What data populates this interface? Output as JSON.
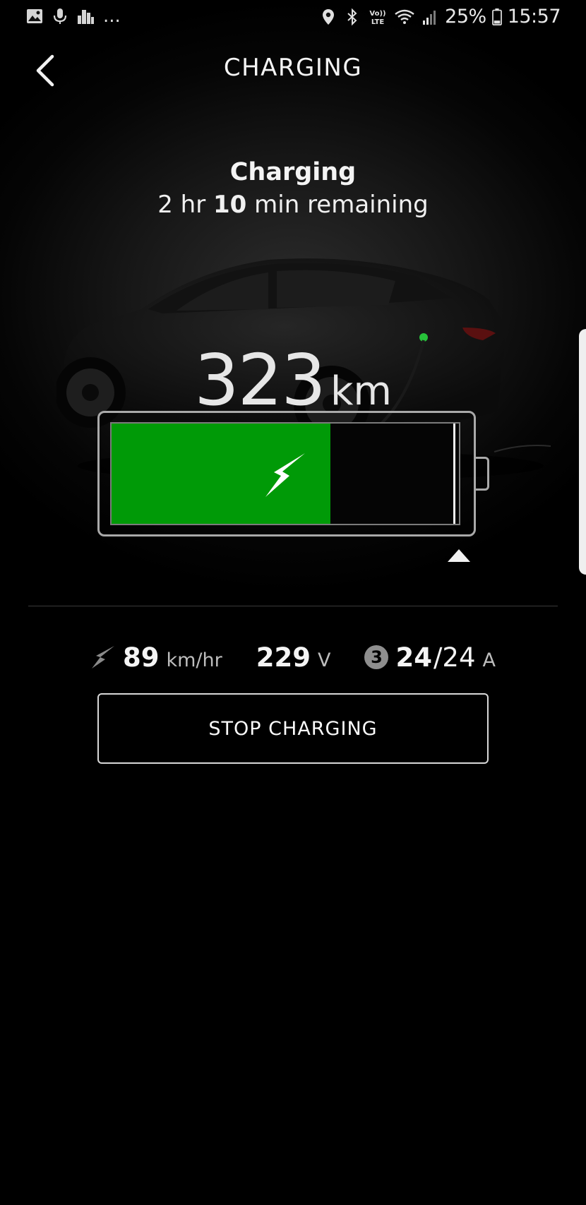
{
  "status_bar": {
    "icons_left": [
      "image-icon",
      "mic-icon",
      "city-icon"
    ],
    "more": "...",
    "icons_right": [
      "location-icon",
      "bluetooth-icon",
      "volte-icon",
      "wifi-icon",
      "signal-icon"
    ],
    "volte_label": "Vo)) LTE",
    "battery_percent": "25%",
    "time": "15:57"
  },
  "header": {
    "title": "CHARGING",
    "back_icon": "chevron-left-icon"
  },
  "charging_status": {
    "title": "Charging",
    "hours": "2 hr ",
    "minutes": "10",
    "remaining_suffix": " min remaining"
  },
  "range": {
    "value": "323",
    "unit": "km"
  },
  "battery": {
    "charge_fraction": 0.63,
    "limit_fraction": 0.99,
    "fill_color": "#009a07",
    "icon": "lightning-bolt-icon"
  },
  "stats": {
    "rate_value": "89",
    "rate_unit": "km/hr",
    "voltage_value": "229",
    "voltage_unit": "V",
    "phase_badge": "3",
    "current_value": "24",
    "current_max": "/24",
    "current_unit": "A"
  },
  "actions": {
    "stop_label": "STOP CHARGING"
  }
}
